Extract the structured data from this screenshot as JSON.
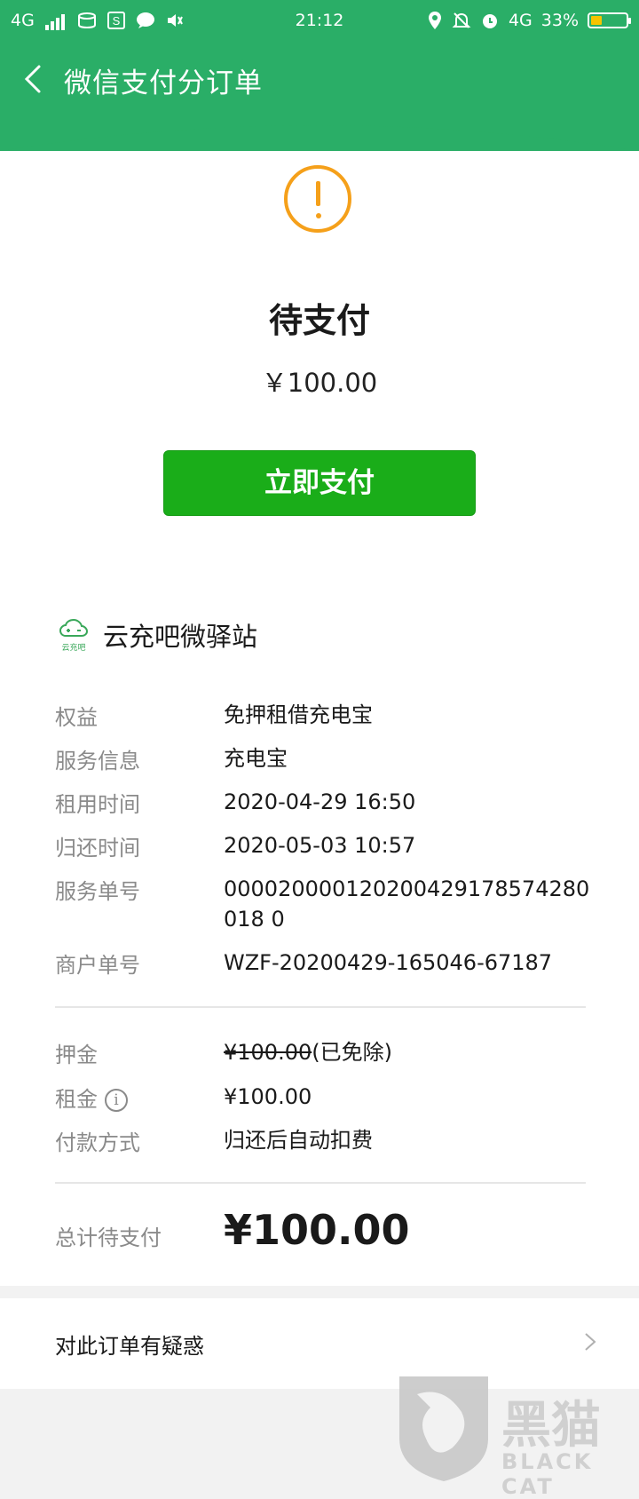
{
  "status_bar": {
    "network": "4G",
    "time": "21:12",
    "network_right": "4G",
    "battery": "33%"
  },
  "header": {
    "title": "微信支付分订单"
  },
  "order": {
    "status": "待支付",
    "amount": "￥100.00",
    "pay_button": "立即支付"
  },
  "merchant": {
    "name": "云充吧微驿站",
    "logo_text": "云充吧"
  },
  "details": [
    {
      "label": "权益",
      "value": "免押租借充电宝"
    },
    {
      "label": "服务信息",
      "value": "充电宝"
    },
    {
      "label": "租用时间",
      "value": "2020-04-29 16:50"
    },
    {
      "label": "归还时间",
      "value": "2020-05-03 10:57"
    },
    {
      "label": "服务单号",
      "value": "000020000120200429178574280018 0"
    },
    {
      "label": "商户单号",
      "value": "WZF-20200429-165046-67187"
    }
  ],
  "fees": {
    "deposit_label": "押金",
    "deposit_value": "¥100.00",
    "deposit_note": "(已免除)",
    "rent_label": "租金",
    "rent_value": "¥100.00",
    "method_label": "付款方式",
    "method_value": "归还后自动扣费"
  },
  "total": {
    "label": "总计待支付",
    "value": "¥100.00"
  },
  "question": {
    "label": "对此订单有疑惑"
  },
  "watermark": {
    "text": "黑猫",
    "sub": "BLACK CAT"
  },
  "colors": {
    "header_green": "#2aae67",
    "pay_green": "#1aad19",
    "warning_orange": "#f5a01a"
  }
}
